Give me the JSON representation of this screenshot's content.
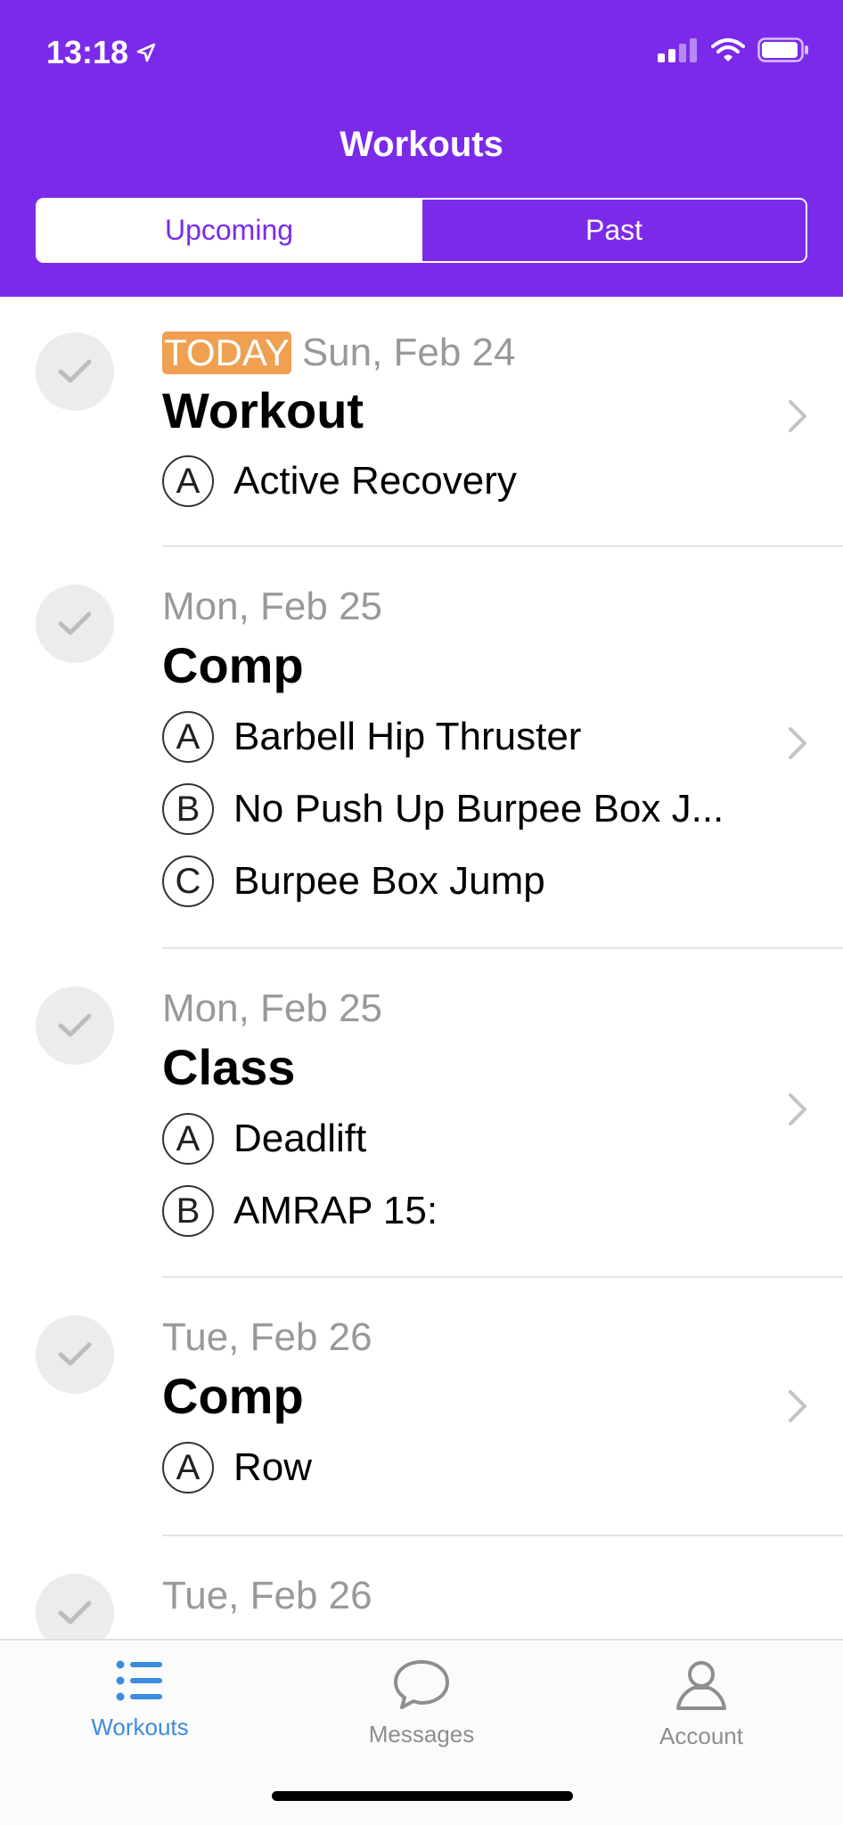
{
  "status_bar": {
    "time": "13:18"
  },
  "nav": {
    "title": "Workouts"
  },
  "segments": {
    "upcoming": "Upcoming",
    "past": "Past",
    "selected": "Upcoming"
  },
  "workouts": [
    {
      "badge": "TODAY",
      "date": "Sun, Feb 24",
      "title": "Workout",
      "items": [
        {
          "letter": "A",
          "name": "Active Recovery"
        }
      ]
    },
    {
      "date": "Mon, Feb 25",
      "title": "Comp",
      "items": [
        {
          "letter": "A",
          "name": "Barbell Hip Thruster"
        },
        {
          "letter": "B",
          "name": "No Push Up Burpee Box J..."
        },
        {
          "letter": "C",
          "name": "Burpee Box Jump"
        }
      ]
    },
    {
      "date": "Mon, Feb 25",
      "title": "Class",
      "items": [
        {
          "letter": "A",
          "name": "Deadlift"
        },
        {
          "letter": "B",
          "name": "AMRAP 15:"
        }
      ]
    },
    {
      "date": "Tue, Feb 26",
      "title": "Comp",
      "items": [
        {
          "letter": "A",
          "name": "Row"
        }
      ]
    },
    {
      "date": "Tue, Feb 26",
      "title": "",
      "items": []
    }
  ],
  "tabbar": {
    "workouts": "Workouts",
    "messages": "Messages",
    "account": "Account",
    "active": "Workouts"
  },
  "colors": {
    "brand": "#7B2AEA",
    "today_badge": "#EFA050",
    "active_tab": "#3D8BE0",
    "inactive_tab": "#8E8E8E"
  },
  "icons": {
    "location": "location-arrow-icon",
    "signal": "cellular-signal-icon",
    "wifi": "wifi-icon",
    "battery": "battery-icon",
    "check": "checkmark-icon",
    "chevron": "chevron-right-icon",
    "workouts_tab": "list-icon",
    "messages_tab": "chat-bubble-icon",
    "account_tab": "person-icon"
  }
}
